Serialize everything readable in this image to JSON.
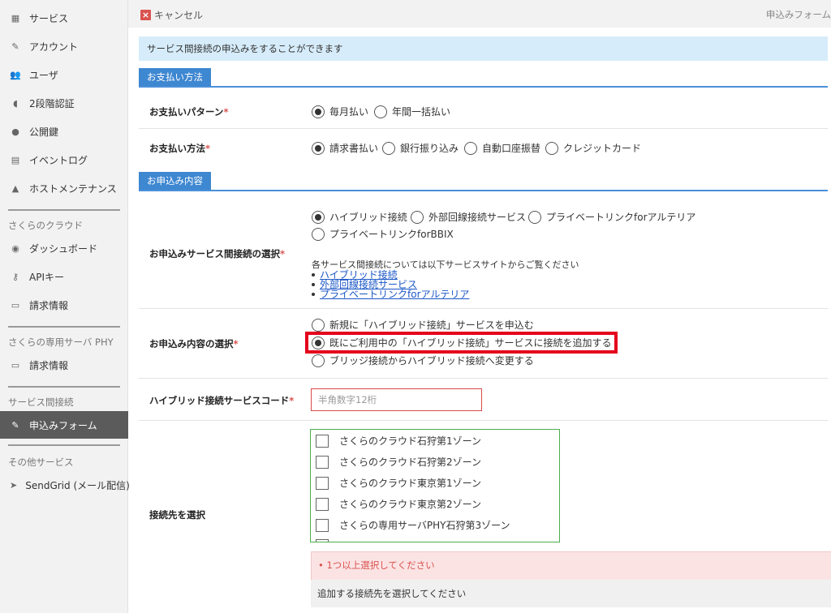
{
  "sidebar": {
    "top_items": [
      {
        "label": "サービス",
        "icon": "grid-icon"
      },
      {
        "label": "アカウント",
        "icon": "wrench-icon"
      },
      {
        "label": "ユーザ",
        "icon": "users-icon"
      },
      {
        "label": "2段階認証",
        "icon": "shield-icon"
      },
      {
        "label": "公開鍵",
        "icon": "key-user-icon"
      },
      {
        "label": "イベントログ",
        "icon": "document-icon"
      },
      {
        "label": "ホストメンテナンス",
        "icon": "warning-icon"
      }
    ],
    "sections": [
      {
        "title": "さくらのクラウド",
        "items": [
          {
            "label": "ダッシュボード",
            "icon": "dashboard-icon"
          },
          {
            "label": "APIキー",
            "icon": "key-icon"
          },
          {
            "label": "請求情報",
            "icon": "card-icon"
          }
        ]
      },
      {
        "title": "さくらの専用サーバ PHY",
        "items": [
          {
            "label": "請求情報",
            "icon": "card-icon"
          }
        ]
      },
      {
        "title": "サービス間接続",
        "items": [
          {
            "label": "申込みフォーム",
            "icon": "wrench-icon",
            "active": true
          }
        ]
      },
      {
        "title": "その他サービス",
        "items": [
          {
            "label": "SendGrid (メール配信)",
            "icon": "send-icon"
          }
        ]
      }
    ]
  },
  "topbar": {
    "cancel_label": "キャンセル",
    "title": "申込みフォーム"
  },
  "info_text": "サービス間接続の申込みをすることができます",
  "payment": {
    "section_title": "お支払い方法",
    "pattern_label": "お支払いパターン",
    "pattern_options": [
      "毎月払い",
      "年間一括払い"
    ],
    "pattern_selected": 0,
    "method_label": "お支払い方法",
    "method_options": [
      "請求書払い",
      "銀行振り込み",
      "自動口座振替",
      "クレジットカード"
    ],
    "method_selected": 0
  },
  "order": {
    "section_title": "お申込み内容",
    "service_label": "お申込みサービス間接続の選択",
    "service_options": [
      "ハイブリッド接続",
      "外部回線接続サービス",
      "プライベートリンクforアルテリア",
      "プライベートリンクforBBIX"
    ],
    "service_selected": 0,
    "service_note": "各サービス間接続については以下サービスサイトからご覧ください",
    "service_links": [
      "ハイブリッド接続",
      "外部回線接続サービス",
      "プライベートリンクforアルテリア"
    ],
    "content_label": "お申込み内容の選択",
    "content_options": [
      "新規に「ハイブリッド接続」サービスを申込む",
      "既にご利用中の「ハイブリッド接続」サービスに接続を追加する",
      "ブリッジ接続からハイブリッド接続へ変更する"
    ],
    "content_selected": 1,
    "code_label": "ハイブリッド接続サービスコード",
    "code_placeholder": "半角数字12桁",
    "dest_label": "接続先を選択",
    "dest_options": [
      "さくらのクラウド石狩第1ゾーン",
      "さくらのクラウド石狩第2ゾーン",
      "さくらのクラウド東京第1ゾーン",
      "さくらのクラウド東京第2ゾーン",
      "さくらの専用サーバPHY石狩第3ゾーン"
    ],
    "error_text": "• 1つ以上選択してください",
    "help_text": "追加する接続先を選択してください",
    "required_mark": "*"
  },
  "colors": {
    "accent": "#3e87d1",
    "error": "#d9534f",
    "highlight": "#e4001b",
    "sidebar_active": "#5b5b5b"
  }
}
